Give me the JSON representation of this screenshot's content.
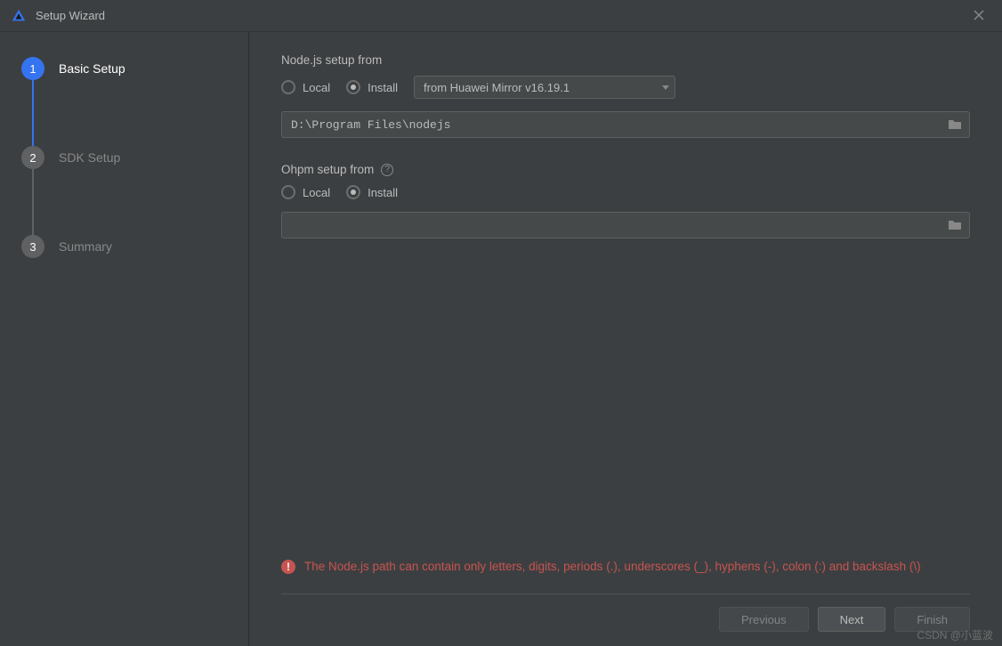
{
  "titlebar": {
    "title": "Setup Wizard"
  },
  "sidebar": {
    "steps": [
      {
        "num": "1",
        "label": "Basic Setup",
        "active": true
      },
      {
        "num": "2",
        "label": "SDK Setup",
        "active": false
      },
      {
        "num": "3",
        "label": "Summary",
        "active": false
      }
    ]
  },
  "nodejs": {
    "section_label": "Node.js setup from",
    "radio_local": "Local",
    "radio_install": "Install",
    "selected": "install",
    "dropdown_value": "from Huawei Mirror v16.19.1",
    "path_value": "D:\\Program Files\\nodejs"
  },
  "ohpm": {
    "section_label": "Ohpm setup from",
    "radio_local": "Local",
    "radio_install": "Install",
    "selected": "install",
    "path_value": ""
  },
  "error": {
    "message": "The Node.js path can contain only letters, digits, periods (.), underscores (_), hyphens (-), colon (:) and backslash (\\)"
  },
  "footer": {
    "previous": "Previous",
    "next": "Next",
    "finish": "Finish"
  },
  "watermark": "CSDN @小蓝波"
}
